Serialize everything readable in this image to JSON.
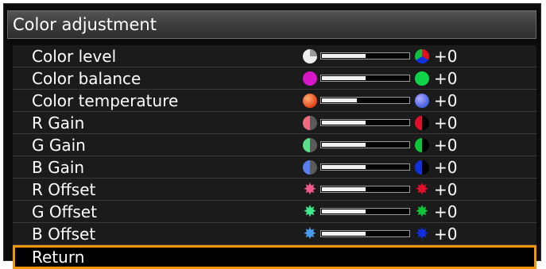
{
  "title": "Color adjustment",
  "items": [
    {
      "label": "Color level",
      "value": "+0",
      "level": 0.5,
      "left_icon": "color-level-low-icon",
      "right_icon": "color-level-high-icon"
    },
    {
      "label": "Color balance",
      "value": "+0",
      "level": 0.5,
      "left_icon": "magenta-dot-icon",
      "right_icon": "green-dot-icon"
    },
    {
      "label": "Color temperature",
      "value": "+0",
      "level": 0.4,
      "left_icon": "warm-color-icon",
      "right_icon": "cool-color-icon"
    },
    {
      "label": "R Gain",
      "value": "+0",
      "level": 0.5,
      "left_icon": "red-gain-low-icon",
      "right_icon": "red-gain-high-icon"
    },
    {
      "label": "G Gain",
      "value": "+0",
      "level": 0.5,
      "left_icon": "green-gain-low-icon",
      "right_icon": "green-gain-high-icon"
    },
    {
      "label": "B Gain",
      "value": "+0",
      "level": 0.5,
      "left_icon": "blue-gain-low-icon",
      "right_icon": "blue-gain-high-icon"
    },
    {
      "label": "R Offset",
      "value": "+0",
      "level": 0.5,
      "left_icon": "red-offset-low-icon",
      "right_icon": "red-offset-high-icon"
    },
    {
      "label": "G Offset",
      "value": "+0",
      "level": 0.5,
      "left_icon": "green-offset-low-icon",
      "right_icon": "green-offset-high-icon"
    },
    {
      "label": "B Offset",
      "value": "+0",
      "level": 0.5,
      "left_icon": "blue-offset-low-icon",
      "right_icon": "blue-offset-high-icon"
    }
  ],
  "return_label": "Return",
  "colors": {
    "selection_border": "#f2960c",
    "red": "#e0102a",
    "green": "#0fd44a",
    "blue": "#1030e0",
    "magenta": "#d616c8",
    "red_offset_low": "#f05a8a",
    "green_offset_low": "#3ee88a",
    "blue_offset_low": "#4a9af0"
  }
}
